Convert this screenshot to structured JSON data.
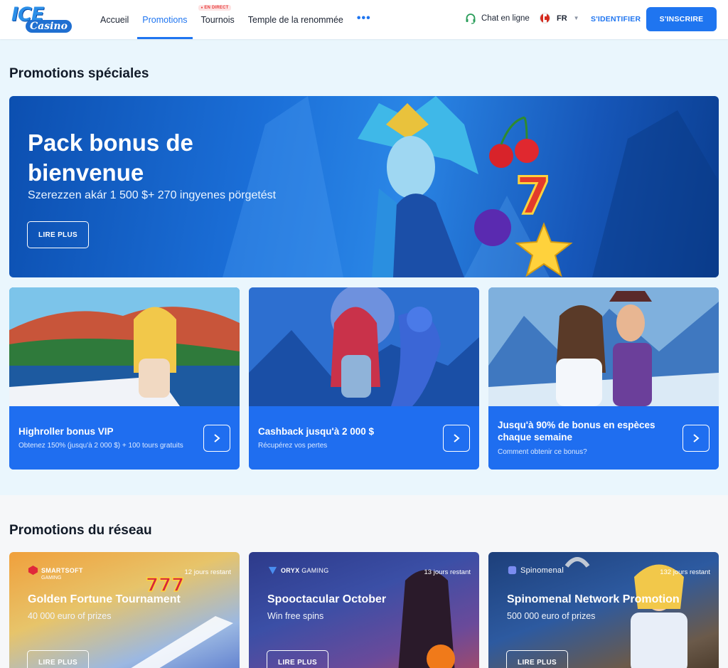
{
  "brand": {
    "logo_top": "ICE",
    "logo_bottom": "Casino",
    "accent": "#1f75f0"
  },
  "header": {
    "nav": [
      {
        "label": "Accueil",
        "active": false
      },
      {
        "label": "Promotions",
        "active": true
      },
      {
        "label": "Tournois",
        "badge": "EN DIRECT"
      },
      {
        "label": "Temple de la renommée"
      }
    ],
    "more_icon": "dots-horizontal-icon",
    "chat_label": "Chat en ligne",
    "language": "FR",
    "login_label": "S'IDENTIFIER",
    "signup_label": "S'INSCRIRE"
  },
  "special": {
    "title": "Promotions spéciales",
    "hero": {
      "title": "Pack bonus de bienvenue",
      "subtitle": "Szerezzen akár 1 500 $+ 270 ingyenes pörgetést",
      "button": "LIRE PLUS"
    },
    "cards": [
      {
        "title": "Highroller bonus VIP",
        "description": "Obtenez 150% (jusqu'à 2 000 $) + 100 tours gratuits"
      },
      {
        "title": "Cashback jusqu'à 2 000 $",
        "description": "Récupérez vos pertes"
      },
      {
        "title": "Jusqu'à 90% de bonus en espèces chaque semaine",
        "description": "Comment obtenir ce bonus?"
      }
    ]
  },
  "network": {
    "title": "Promotions du réseau",
    "cards": [
      {
        "provider": "SMARTSOFT",
        "provider_sub": "GAMING",
        "days": "12 jours restant",
        "title": "Golden Fortune Tournament",
        "subtitle": "40 000 euro of prizes",
        "button": "LIRE PLUS"
      },
      {
        "provider": "ORYX",
        "provider_sub": "GAMING",
        "days": "13 jours restant",
        "title": "Spooctacular October",
        "subtitle": "Win free spins",
        "button": "LIRE PLUS"
      },
      {
        "provider": "Spinomenal",
        "days": "132 jours restant",
        "title": "Spinomenal Network Promotion",
        "subtitle": "500 000 euro of prizes",
        "button": "LIRE PLUS"
      }
    ]
  }
}
